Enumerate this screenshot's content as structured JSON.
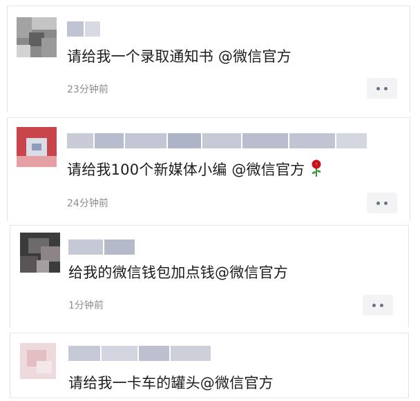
{
  "comments": [
    {
      "text": "请给我一个录取通知书 @微信官方",
      "time": "23分钟前"
    },
    {
      "text": "请给我100个新媒体小编 @微信官方",
      "time": "24分钟前",
      "trailing_icon": "rose-icon"
    },
    {
      "text": "给我的微信钱包加点钱@微信官方",
      "time": "1分钟前"
    },
    {
      "text": "请给我一卡车的罐头@微信官方"
    }
  ],
  "more_icon": "more-dots-icon",
  "colors": {
    "text": "#1c1c1c",
    "time": "#8c8c8c",
    "more_bg": "#f3f3f5",
    "dots": "#6a7387"
  }
}
